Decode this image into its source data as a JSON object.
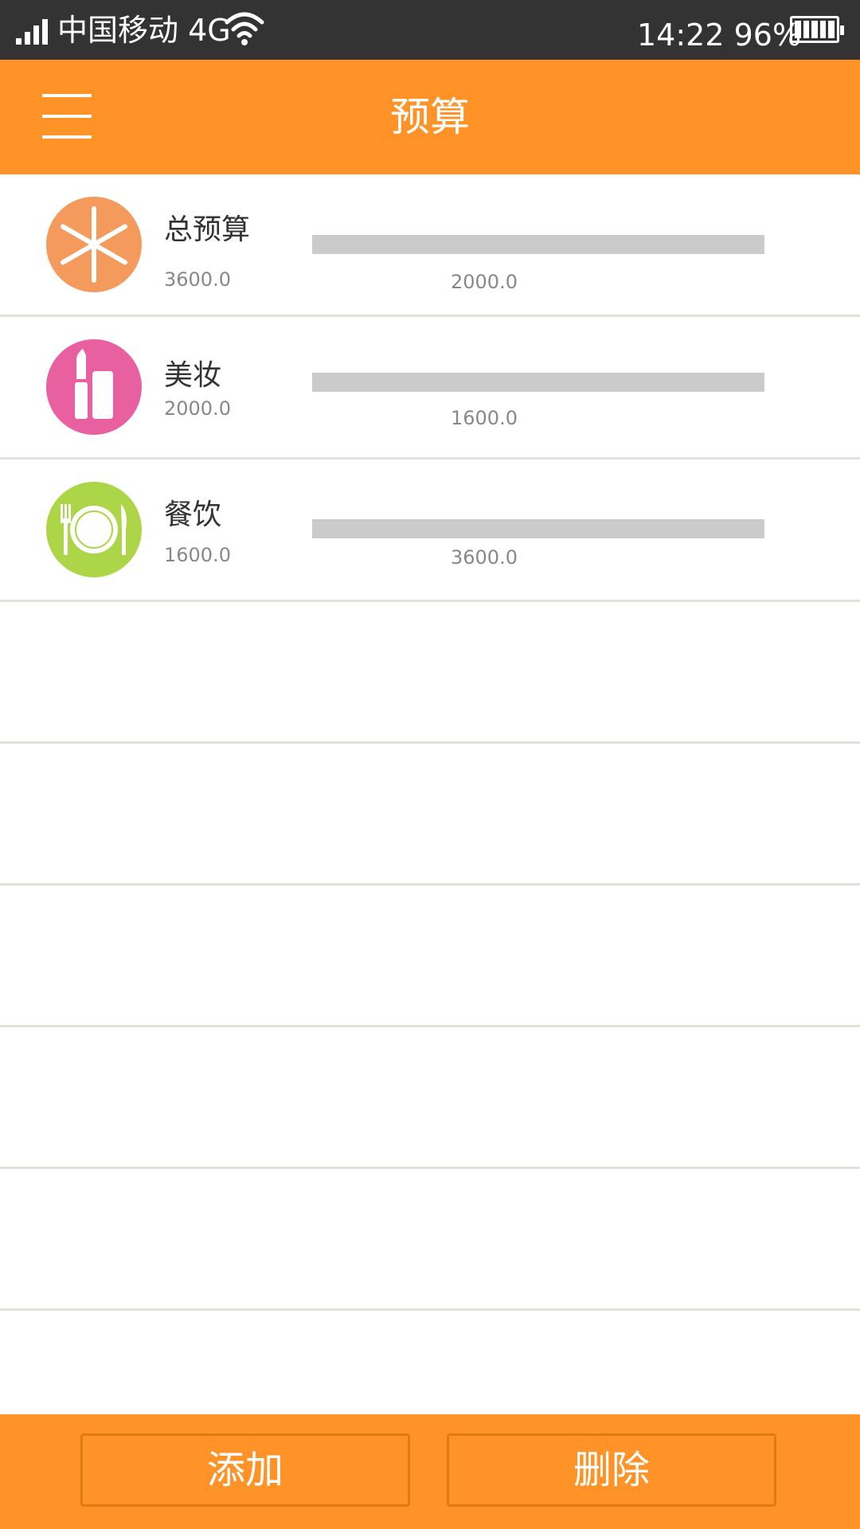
{
  "status_bar": {
    "carrier": "中国移动 4G",
    "time": "14:22 96%"
  },
  "header": {
    "title": "预算",
    "background": "#ff9327"
  },
  "budget_items": [
    {
      "name": "总预算",
      "amount": "3600.0",
      "bar_value": "2000.0",
      "icon": "asterisk-icon",
      "color": "#f39a5c"
    },
    {
      "name": "美妆",
      "amount": "2000.0",
      "bar_value": "1600.0",
      "icon": "lipstick-icon",
      "color": "#e8609f"
    },
    {
      "name": "餐饮",
      "amount": "1600.0",
      "bar_value": "3600.0",
      "icon": "plate-cutlery-icon",
      "color": "#acd648"
    }
  ],
  "bottom_bar": {
    "add_label": "添加",
    "delete_label": "删除"
  }
}
